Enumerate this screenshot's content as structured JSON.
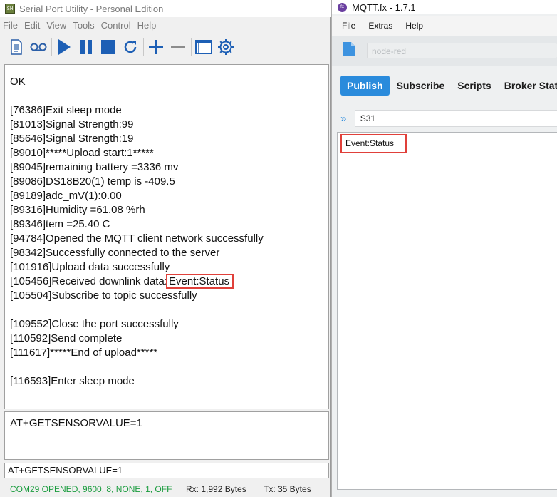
{
  "serial": {
    "title": "Serial Port Utility - Personal Edition",
    "icon_text": "SH",
    "menu": [
      "File",
      "Edit",
      "View",
      "Tools",
      "Control",
      "Help"
    ],
    "toolbar_icons": [
      "document-icon",
      "tape-icon",
      "play-icon",
      "pause-icon",
      "stop-icon",
      "refresh-icon",
      "plus-icon",
      "minus-icon",
      "window-icon",
      "gear-icon"
    ],
    "output_lines": [
      "OK",
      "",
      "[76386]Exit sleep mode",
      "[81013]Signal Strength:99",
      "[85646]Signal Strength:19",
      "[89010]*****Upload start:1*****",
      "[89045]remaining battery =3336 mv",
      "[89086]DS18B20(1) temp is -409.5",
      "[89189]adc_mV(1):0.00",
      "[89316]Humidity =61.08 %rh",
      "[89346]tem =25.40 C",
      "[94784]Opened the MQTT client network successfully",
      "[98342]Successfully connected to the server",
      "[101916]Upload data successfully",
      "[105456]Received downlink data:",
      "[105504]Subscribe to topic successfully",
      "",
      "[109552]Close the port successfully",
      "[110592]Send complete",
      "[111617]*****End of upload*****",
      "",
      "[116593]Enter sleep mode"
    ],
    "highlight_text": "Event:Status",
    "input_text": "AT+GETSENSORVALUE=1",
    "command_combo": "AT+GETSENSORVALUE=1",
    "status": {
      "connection": "COM29 OPENED, 9600, 8, NONE, 1, OFF",
      "rx": "Rx: 1,992 Bytes",
      "tx": "Tx: 35 Bytes",
      "connection_color": "#1a9c3e"
    }
  },
  "mqtt": {
    "title": "MQTT.fx - 1.7.1",
    "menu": [
      "File",
      "Extras",
      "Help"
    ],
    "profile": "node-red",
    "tabs": [
      "Publish",
      "Subscribe",
      "Scripts",
      "Broker Status"
    ],
    "active_tab": "Publish",
    "topic": "S31",
    "payload": "Event:Status",
    "accent_color": "#2a8bdc",
    "highlight_color": "#e0403a"
  }
}
